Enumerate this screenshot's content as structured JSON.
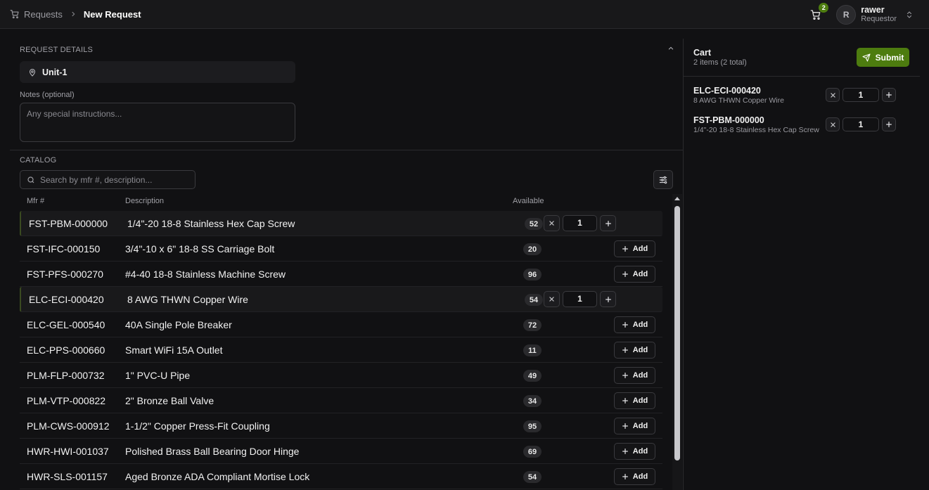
{
  "breadcrumb": {
    "parent": "Requests",
    "current": "New Request"
  },
  "header": {
    "cart_count": "2",
    "user": {
      "initial": "R",
      "name": "rawer",
      "role": "Requestor"
    }
  },
  "details": {
    "section_label": "REQUEST DETAILS",
    "location": "Unit-1",
    "notes_label": "Notes (optional)",
    "notes_placeholder": "Any special instructions...",
    "notes_value": ""
  },
  "catalog": {
    "section_label": "CATALOG",
    "search_placeholder": "Search by mfr #, description...",
    "columns": {
      "mfr": "Mfr #",
      "description": "Description",
      "available": "Available"
    },
    "add_label": "Add",
    "rows": [
      {
        "mfr": "FST-PBM-000000",
        "description": "1/4\"-20 18-8 Stainless Hex Cap Screw",
        "available": "52",
        "in_cart": true,
        "qty": "1"
      },
      {
        "mfr": "FST-IFC-000150",
        "description": "3/4\"-10 x 6\" 18-8 SS Carriage Bolt",
        "available": "20",
        "in_cart": false
      },
      {
        "mfr": "FST-PFS-000270",
        "description": "#4-40 18-8 Stainless Machine Screw",
        "available": "96",
        "in_cart": false
      },
      {
        "mfr": "ELC-ECI-000420",
        "description": "8 AWG THWN Copper Wire",
        "available": "54",
        "in_cart": true,
        "qty": "1"
      },
      {
        "mfr": "ELC-GEL-000540",
        "description": "40A Single Pole Breaker",
        "available": "72",
        "in_cart": false
      },
      {
        "mfr": "ELC-PPS-000660",
        "description": "Smart WiFi 15A Outlet",
        "available": "11",
        "in_cart": false
      },
      {
        "mfr": "PLM-FLP-000732",
        "description": "1\" PVC-U Pipe",
        "available": "49",
        "in_cart": false
      },
      {
        "mfr": "PLM-VTP-000822",
        "description": "2\" Bronze Ball Valve",
        "available": "34",
        "in_cart": false
      },
      {
        "mfr": "PLM-CWS-000912",
        "description": "1-1/2\" Copper Press-Fit Coupling",
        "available": "95",
        "in_cart": false
      },
      {
        "mfr": "HWR-HWI-001037",
        "description": "Polished Brass Ball Bearing Door Hinge",
        "available": "69",
        "in_cart": false
      },
      {
        "mfr": "HWR-SLS-001157",
        "description": "Aged Bronze ADA Compliant Mortise Lock",
        "available": "54",
        "in_cart": false
      }
    ]
  },
  "cart": {
    "title": "Cart",
    "summary": "2 items (2 total)",
    "submit_label": "Submit",
    "items": [
      {
        "mfr": "ELC-ECI-000420",
        "description": "8 AWG THWN Copper Wire",
        "qty": "1"
      },
      {
        "mfr": "FST-PBM-000000",
        "description": "1/4\"-20 18-8 Stainless Hex Cap Screw",
        "qty": "1"
      }
    ]
  },
  "colors": {
    "accent": "#4d7c0f",
    "background": "#111113",
    "panel": "#18181a"
  },
  "icons": [
    "cart-icon",
    "chevron-right-icon",
    "chevron-up-down-icon",
    "chevron-up-icon",
    "map-pin-icon",
    "search-icon",
    "sliders-icon",
    "x-icon",
    "plus-icon",
    "send-icon"
  ]
}
